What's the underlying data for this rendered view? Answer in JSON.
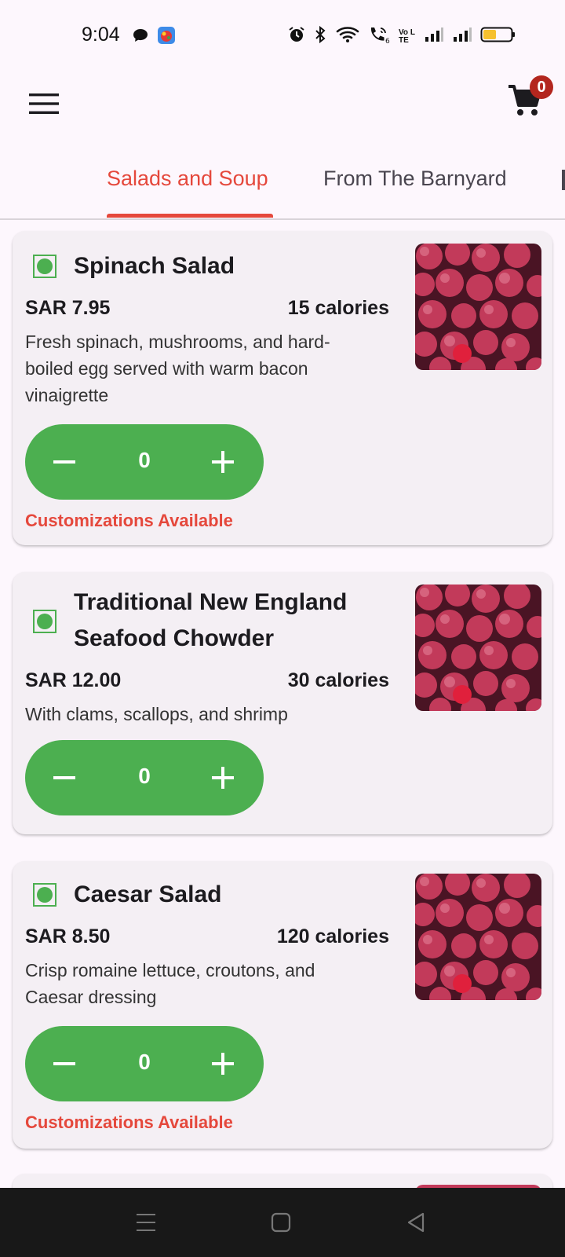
{
  "status_bar": {
    "time": "9:04",
    "icons": [
      "chat-icon",
      "app-icon",
      "alarm-icon",
      "bluetooth-icon",
      "wifi-icon",
      "wifi-calling-icon",
      "volte-icon",
      "signal-icon",
      "signal-icon",
      "battery-icon"
    ],
    "volte_label": "Vo LTE"
  },
  "app_bar": {
    "cart_count": "0"
  },
  "tabs": [
    {
      "label": "Salads and Soup",
      "active": true
    },
    {
      "label": "From The Barnyard",
      "active": false
    }
  ],
  "items": [
    {
      "name": "Spinach Salad",
      "price": "SAR 7.95",
      "calories": "15 calories",
      "description": "Fresh spinach, mushrooms, and hard-boiled egg served with warm bacon vinaigrette",
      "quantity": "0",
      "customizations": "Customizations Available"
    },
    {
      "name": "Traditional New England Seafood Chowder",
      "price": "SAR 12.00",
      "calories": "30 calories",
      "description": "With clams, scallops, and shrimp",
      "quantity": "0",
      "customizations": ""
    },
    {
      "name": "Caesar Salad",
      "price": "SAR 8.50",
      "calories": "120 calories",
      "description": "Crisp romaine lettuce, croutons, and Caesar dressing",
      "quantity": "0",
      "customizations": "Customizations Available"
    }
  ],
  "colors": {
    "accent": "#e5483c",
    "stepper": "#4caf50",
    "badge": "#b3261e",
    "card": "#f4eff4",
    "background": "#fdf7fd"
  }
}
